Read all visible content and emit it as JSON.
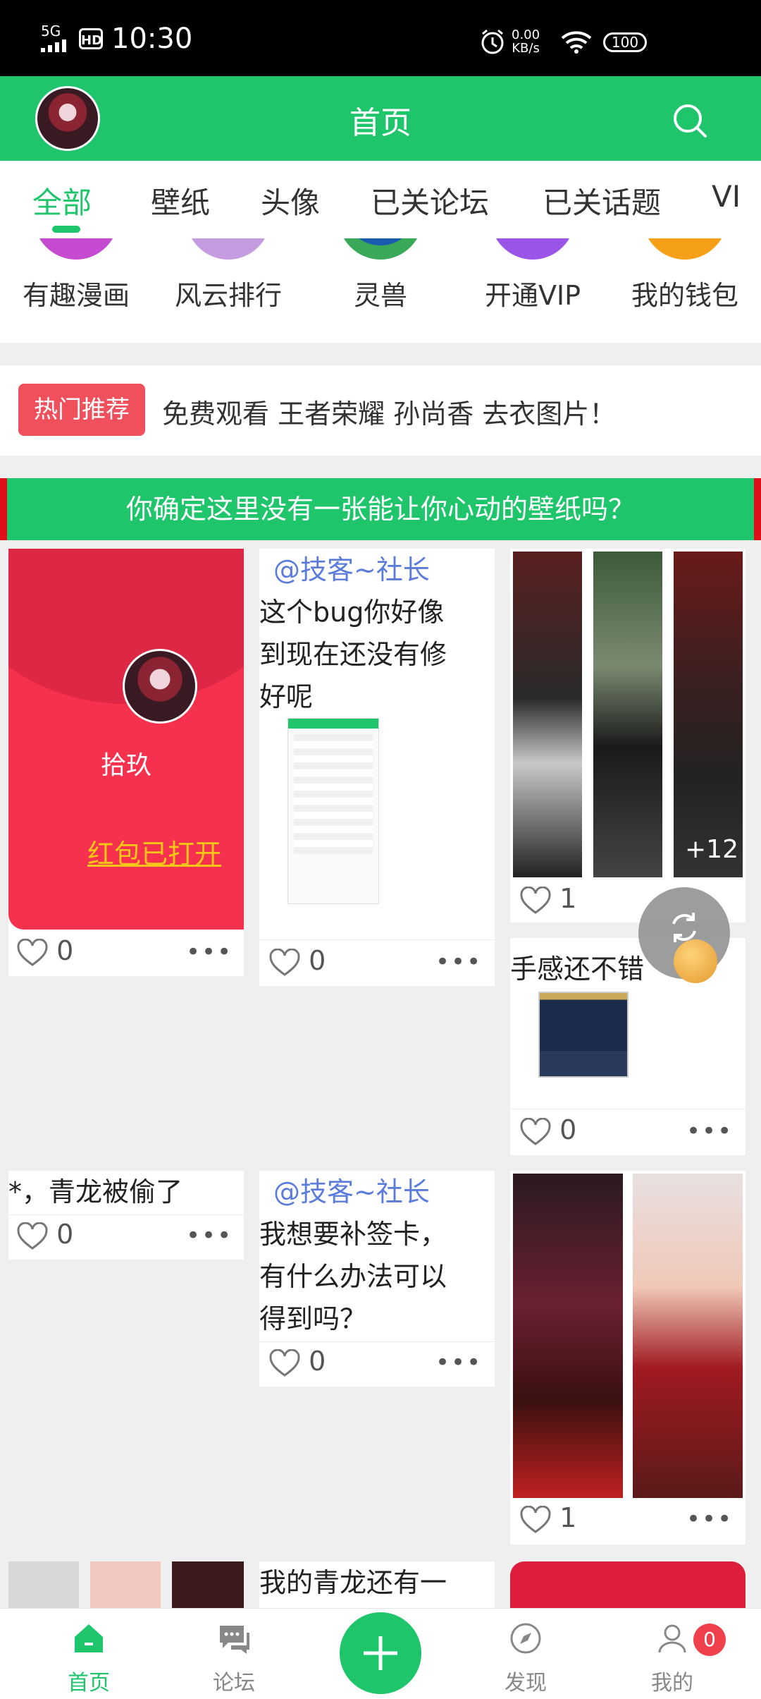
{
  "status_bar": {
    "time": "10:30",
    "network": "5G",
    "hd": "HD",
    "speed": "0.00",
    "speed_unit": "KB/s",
    "battery": "100"
  },
  "header": {
    "title": "首页"
  },
  "tabs": [
    {
      "label": "全部",
      "active": true
    },
    {
      "label": "壁纸"
    },
    {
      "label": "头像"
    },
    {
      "label": "已关论坛"
    },
    {
      "label": "已关话题"
    },
    {
      "label": "VI"
    }
  ],
  "quick_links": [
    {
      "label": "有趣漫画",
      "color": "#c44bd0"
    },
    {
      "label": "风云排行",
      "color": "#c59be0"
    },
    {
      "label": "灵兽",
      "color": "#3aa859"
    },
    {
      "label": "开通VIP",
      "color": "#9a55e8"
    },
    {
      "label": "我的钱包",
      "color": "#f5a018"
    }
  ],
  "hot": {
    "badge": "热门推荐",
    "text": "免费观看 王者荣耀 孙尚香 去衣图片！"
  },
  "banner": "你确定这里没有一张能让你心动的壁纸吗？",
  "posts": {
    "red_packet": {
      "name": "拾玖",
      "status": "红包已打开",
      "likes": "0"
    },
    "bug": {
      "mention": "@技客~社长",
      "text": [
        "这个bug你好像",
        "到现在还没有修",
        "好呢"
      ],
      "likes": "0"
    },
    "gallery": {
      "more_count": "+12",
      "likes": "1"
    },
    "handfeel": {
      "text": "手感还不错",
      "likes": "0"
    },
    "qinglong": {
      "text": "*，青龙被偷了",
      "likes": "0"
    },
    "signin": {
      "mention": "@技客~社长",
      "text": [
        "我想要补签卡，",
        "有什么办法可以",
        "得到吗？"
      ],
      "likes": "0"
    },
    "anime": {
      "likes": "1"
    },
    "bottom": {
      "text": "我的青龙还有一"
    }
  },
  "bottom_nav": [
    {
      "label": "首页",
      "active": true
    },
    {
      "label": "论坛"
    },
    {
      "label": "发现"
    },
    {
      "label": "我的"
    }
  ],
  "message_badge": "0",
  "colors": {
    "brand": "#1ec56b",
    "hot": "#f0505c",
    "mention": "#5b7cdb",
    "packet": "#f5314e"
  }
}
